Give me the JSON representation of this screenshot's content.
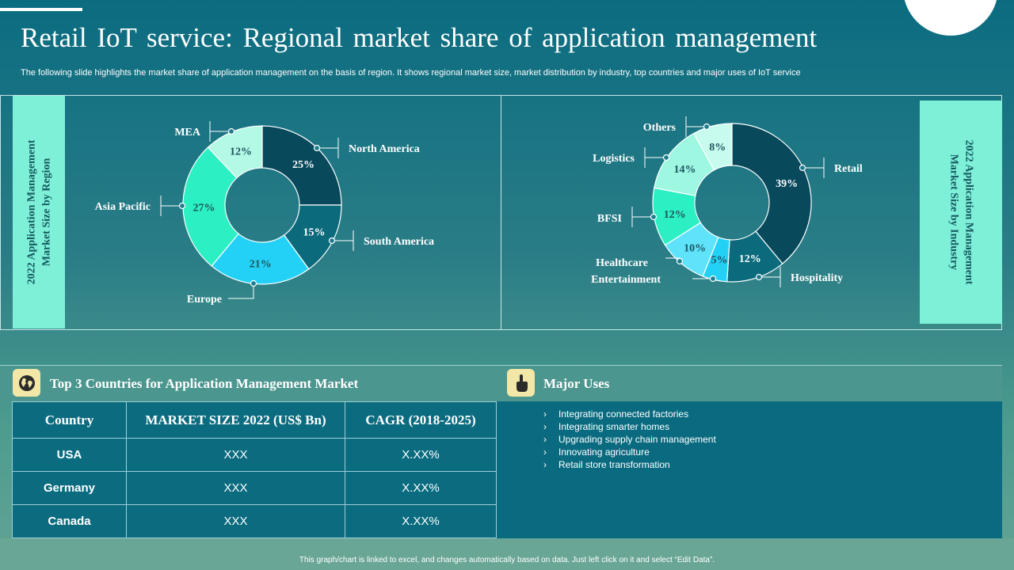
{
  "title": "Retail IoT service: Regional market share of application management",
  "subtitle": "The following slide highlights the market share of application management on the basis of region. It shows regional market size, market distribution by industry, top countries and major uses of IoT service",
  "chart_data": [
    {
      "type": "pie",
      "title": "2022 Application  Management Market Size by Region",
      "title_lines": [
        "2022 Application  Management",
        "Market Size by Region"
      ],
      "categories": [
        "North America",
        "South America",
        "Europe",
        "Asia Pacific",
        "MEA"
      ],
      "values": [
        25,
        15,
        21,
        27,
        12
      ],
      "labels": [
        "25%",
        "15%",
        "21%",
        "27%",
        "12%"
      ],
      "colors": [
        "#08495c",
        "#0b6a7c",
        "#22d1f5",
        "#2cf0c4",
        "#b3f9e5"
      ]
    },
    {
      "type": "pie",
      "title": "2022 Application  Management Market Size by Industry",
      "title_lines": [
        "2022 Application  Management",
        "Market Size by Industry"
      ],
      "categories": [
        "Retail",
        "Hospitality",
        "Entertainment",
        "Healthcare",
        "BFSI",
        "Logistics",
        "Others"
      ],
      "values": [
        39,
        12,
        5,
        10,
        12,
        14,
        8
      ],
      "labels": [
        "39%",
        "12%",
        "5%",
        "10%",
        "12%",
        "14%",
        "8%"
      ],
      "colors": [
        "#08495c",
        "#0b6a7c",
        "#22d1f5",
        "#5ee3fa",
        "#2cf0c4",
        "#9df7e1",
        "#c7fbee"
      ]
    }
  ],
  "countries": {
    "heading": "Top 3 Countries for Application Management Market",
    "icon": "globe-icon",
    "columns": [
      "Country",
      "MARKET SIZE 2022 (US$ Bn)",
      "CAGR (2018-2025)"
    ],
    "rows": [
      [
        "USA",
        "XXX",
        "X.XX%"
      ],
      [
        "Germany",
        "XXX",
        "X.XX%"
      ],
      [
        "Canada",
        "XXX",
        "X.XX%"
      ]
    ]
  },
  "uses": {
    "heading": "Major Uses",
    "icon": "hand-pointer-icon",
    "bullet": "›",
    "items": [
      "Integrating  connected factories",
      "Integrating  smarter homes",
      "Upgrading  supply chain management",
      "Innovating  agriculture",
      "Retail store transformation"
    ]
  },
  "footer_note": "This graph/chart is linked to excel, and changes automatically based on data. Just left click on it and select “Edit Data”.",
  "colors": {
    "panel_accent": "#7ff0d8",
    "icon_bg": "#f2e7a6",
    "table_bg": "#0b6c80"
  }
}
